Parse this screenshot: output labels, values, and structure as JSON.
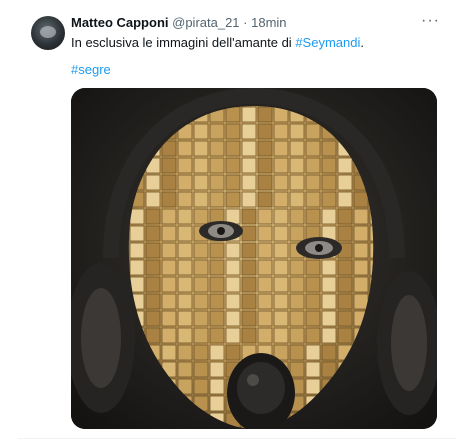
{
  "tweet": {
    "author_name": "Matteo Capponi",
    "handle": "@pirata_21",
    "separator": "·",
    "time": "18min",
    "text_prefix": "In esclusiva le immagini dell'amante di ",
    "text_hashtag": "#Seymandi",
    "text_suffix": ".",
    "hashtag_line": "#segre",
    "more_icon": "more-horizontal-icon"
  },
  "colors": {
    "link": "#1d9bf0",
    "secondary_text": "#536471",
    "primary_text": "#0f1419"
  }
}
